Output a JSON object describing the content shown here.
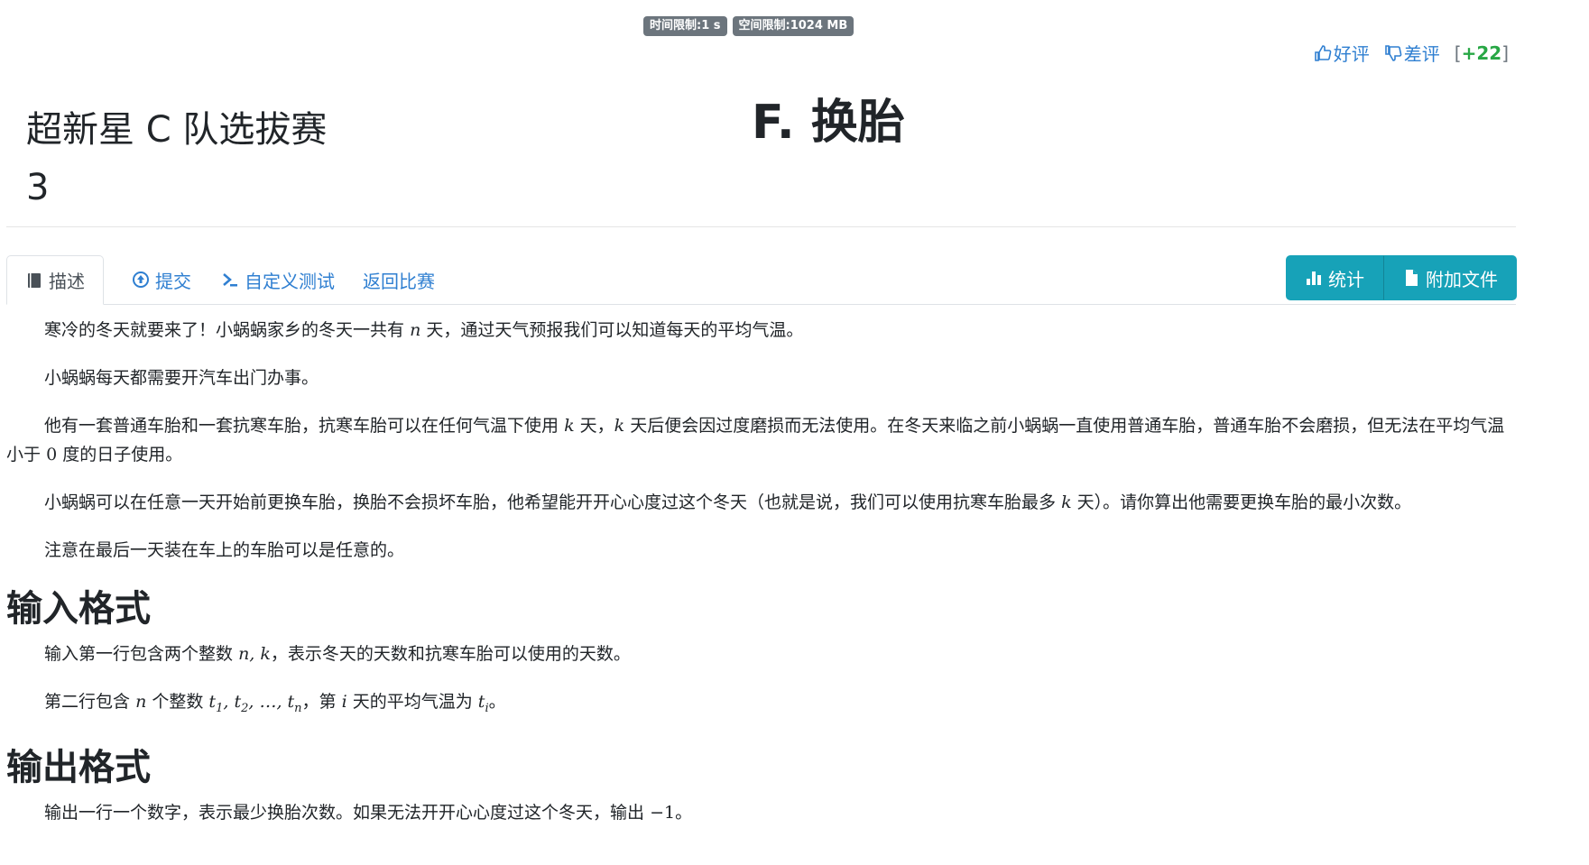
{
  "limits": {
    "time": "时间限制:1 s",
    "memory": "空间限制:1024 MB"
  },
  "ratings": {
    "good": "好评",
    "bad": "差评",
    "score_open": "[",
    "score_value": "+22",
    "score_close": "]"
  },
  "header": {
    "contest_title_line1": "超新星 C 队选拔赛",
    "contest_title_line2": "3",
    "problem_title": "F. 换胎"
  },
  "tabs": [
    {
      "label": "描述",
      "icon": "book-icon",
      "active": true
    },
    {
      "label": "提交",
      "icon": "upload-circle-icon",
      "active": false
    },
    {
      "label": "自定义测试",
      "icon": "terminal-icon",
      "active": false
    },
    {
      "label": "返回比赛",
      "icon": "",
      "active": false
    }
  ],
  "buttons": {
    "stats": "统计",
    "attachments": "附加文件"
  },
  "statement": {
    "p1_a": "寒冷的冬天就要来了！小蜗蜗家乡的冬天一共有",
    "p1_var": "n",
    "p1_b": "天，通过天气预报我们可以知道每天的平均气温。",
    "p2": "小蜗蜗每天都需要开汽车出门办事。",
    "p3_a": "他有一套普通车胎和一套抗寒车胎，抗寒车胎可以在任何气温下使用",
    "p3_k1": "k",
    "p3_b": "天，",
    "p3_k2": "k",
    "p3_c": "天后便会因过度磨损而无法使用。在冬天来临之前小蜗蜗一直使用普通车胎，普通车胎不会磨损，但无法在平均气温小于",
    "p3_zero": "0",
    "p3_d": "度的日子使用。",
    "p4_a": "小蜗蜗可以在任意一天开始前更换车胎，换胎不会损坏车胎，他希望能开开心心度过这个冬天（也就是说，我们可以使用抗寒车胎最多",
    "p4_k": "k",
    "p4_b": "天）。请你算出他需要更换车胎的最小次数。",
    "p5": "注意在最后一天装在车上的车胎可以是任意的。"
  },
  "input_section": {
    "heading": "输入格式",
    "l1_a": "输入第一行包含两个整数",
    "l1_vars": "n, k",
    "l1_b": "，表示冬天的天数和抗寒车胎可以使用的天数。",
    "l2_a": "第二行包含",
    "l2_n": "n",
    "l2_b": "个整数",
    "l2_seq": "t",
    "l2_s1": "1",
    "l2_s2": "2",
    "l2_dots": ", …, ",
    "l2_sn": "n",
    "l2_c": "，第",
    "l2_i": "i",
    "l2_d": "天的平均气温为",
    "l2_ti": "t",
    "l2_ti_sub": "i",
    "l2_e": "。"
  },
  "output_section": {
    "heading": "输出格式",
    "l1_a": "输出一行一个数字，表示最少换胎次数。如果无法开开心心度过这个冬天，输出",
    "l1_val": "−1",
    "l1_b": "。"
  },
  "colors": {
    "link": "#2f7fd1",
    "info_button": "#17a2b8",
    "badge": "#6c757d",
    "score": "#28a745"
  }
}
